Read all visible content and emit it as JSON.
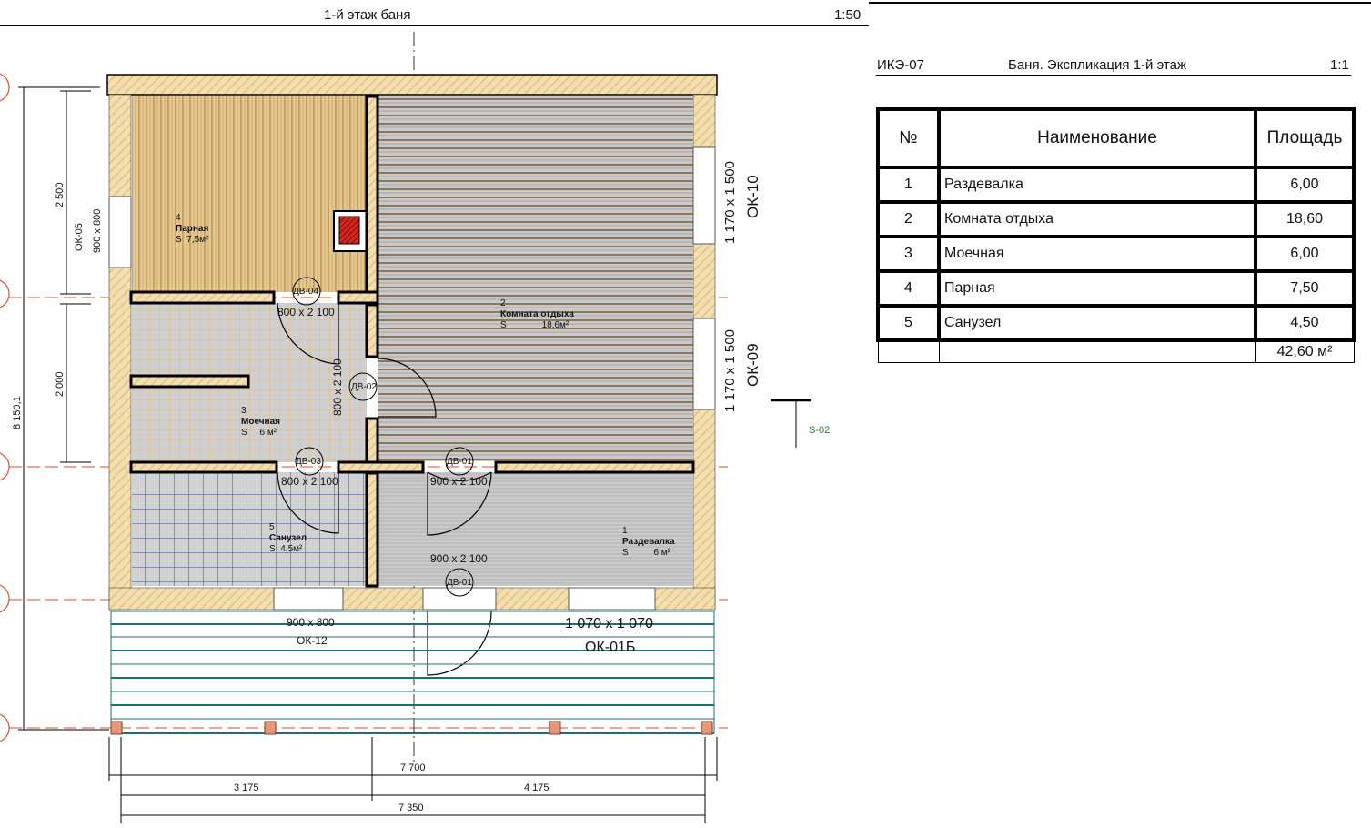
{
  "drawing": {
    "title": "1-й этаж баня",
    "scale": "1:50"
  },
  "rooms": [
    {
      "num": "4",
      "name": "Парная",
      "area": "S  7,5м²"
    },
    {
      "num": "2",
      "name": "Комната отдыха",
      "area": "S              18,6м²"
    },
    {
      "num": "3",
      "name": "Моечная",
      "area": "S     6 м²"
    },
    {
      "num": "5",
      "name": "Санузел",
      "area": "S  4,5м²"
    },
    {
      "num": "1",
      "name": "Раздевалка",
      "area": "S          6 м²"
    }
  ],
  "doors": {
    "dv04": "ДВ-04",
    "dv02": "ДВ-02",
    "dv03": "ДВ-03",
    "dv01a": "ДВ-01",
    "dv01b": "ДВ-01",
    "d800a": "800 x 2 100",
    "d800b": "800 x 2 100",
    "d800c": "800 x 2 100",
    "d900a": "900 x 2 100",
    "d900b": "900 x 2 100"
  },
  "windows": {
    "ok05": "ОК-05",
    "ok05size": "900 x 800",
    "ok10": "ОК-10",
    "ok10size": "1 170 x 1 500",
    "ok09": "ОК-09",
    "ok09size": "1 170 x 1 500",
    "ok12": "ОК-12",
    "ok12size": "900 x 800",
    "ok01b": "ОК-01Б",
    "ok01bsize": "1 070 x 1 070"
  },
  "section": "S-02",
  "dims": {
    "d2500": "2 500",
    "d2000": "2 000",
    "d8150": "8 150,1",
    "d7700": "7 700",
    "d3175": "3 175",
    "d4175": "4 175",
    "d7350": "7 350"
  },
  "schedule": {
    "code": "ИКЭ-07",
    "title": "Баня. Экспликация 1-й этаж",
    "scale": "1:1",
    "headers": {
      "num": "№",
      "name": "Наименование",
      "area": "Площадь"
    },
    "rows": [
      {
        "num": "1",
        "name": "Раздевалка",
        "area": "6,00"
      },
      {
        "num": "2",
        "name": "Комната отдыха",
        "area": "18,60"
      },
      {
        "num": "3",
        "name": "Моечная",
        "area": "6,00"
      },
      {
        "num": "4",
        "name": "Парная",
        "area": "7,50"
      },
      {
        "num": "5",
        "name": "Санузел",
        "area": "4,50"
      }
    ],
    "total": "42,60 м²"
  },
  "colors": {
    "wood": "#e9c27a",
    "woodLight": "#f4dfae",
    "greyFloor": "#c8c8c8",
    "tileBlue": "#2a4fd6",
    "terrace": "#1c6f73",
    "axis": "#e24a2a"
  }
}
